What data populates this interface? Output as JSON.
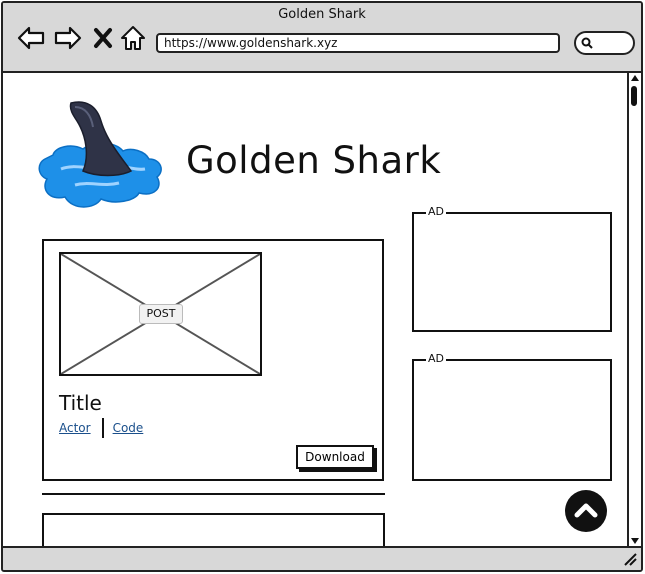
{
  "window": {
    "title": "Golden Shark",
    "url": "https://www.goldenshark.xyz"
  },
  "icons": {
    "back": "back-arrow-icon",
    "forward": "forward-arrow-icon",
    "stop": "close-icon",
    "home": "home-icon",
    "search": "search-icon",
    "scroll_to_top": "chevron-up-icon",
    "logo": "shark-fin-logo"
  },
  "header": {
    "site_title": "Golden Shark"
  },
  "post": {
    "image_placeholder": "POST",
    "title": "Title",
    "links": [
      "Actor",
      "Code"
    ],
    "download_label": "Download"
  },
  "ads": [
    {
      "label": "AD"
    },
    {
      "label": "AD"
    }
  ],
  "colors": {
    "chrome": "#d8d8d8",
    "link": "#1a4f8b",
    "logo_water": "#1e90e8",
    "logo_fin": "#2f3347"
  }
}
